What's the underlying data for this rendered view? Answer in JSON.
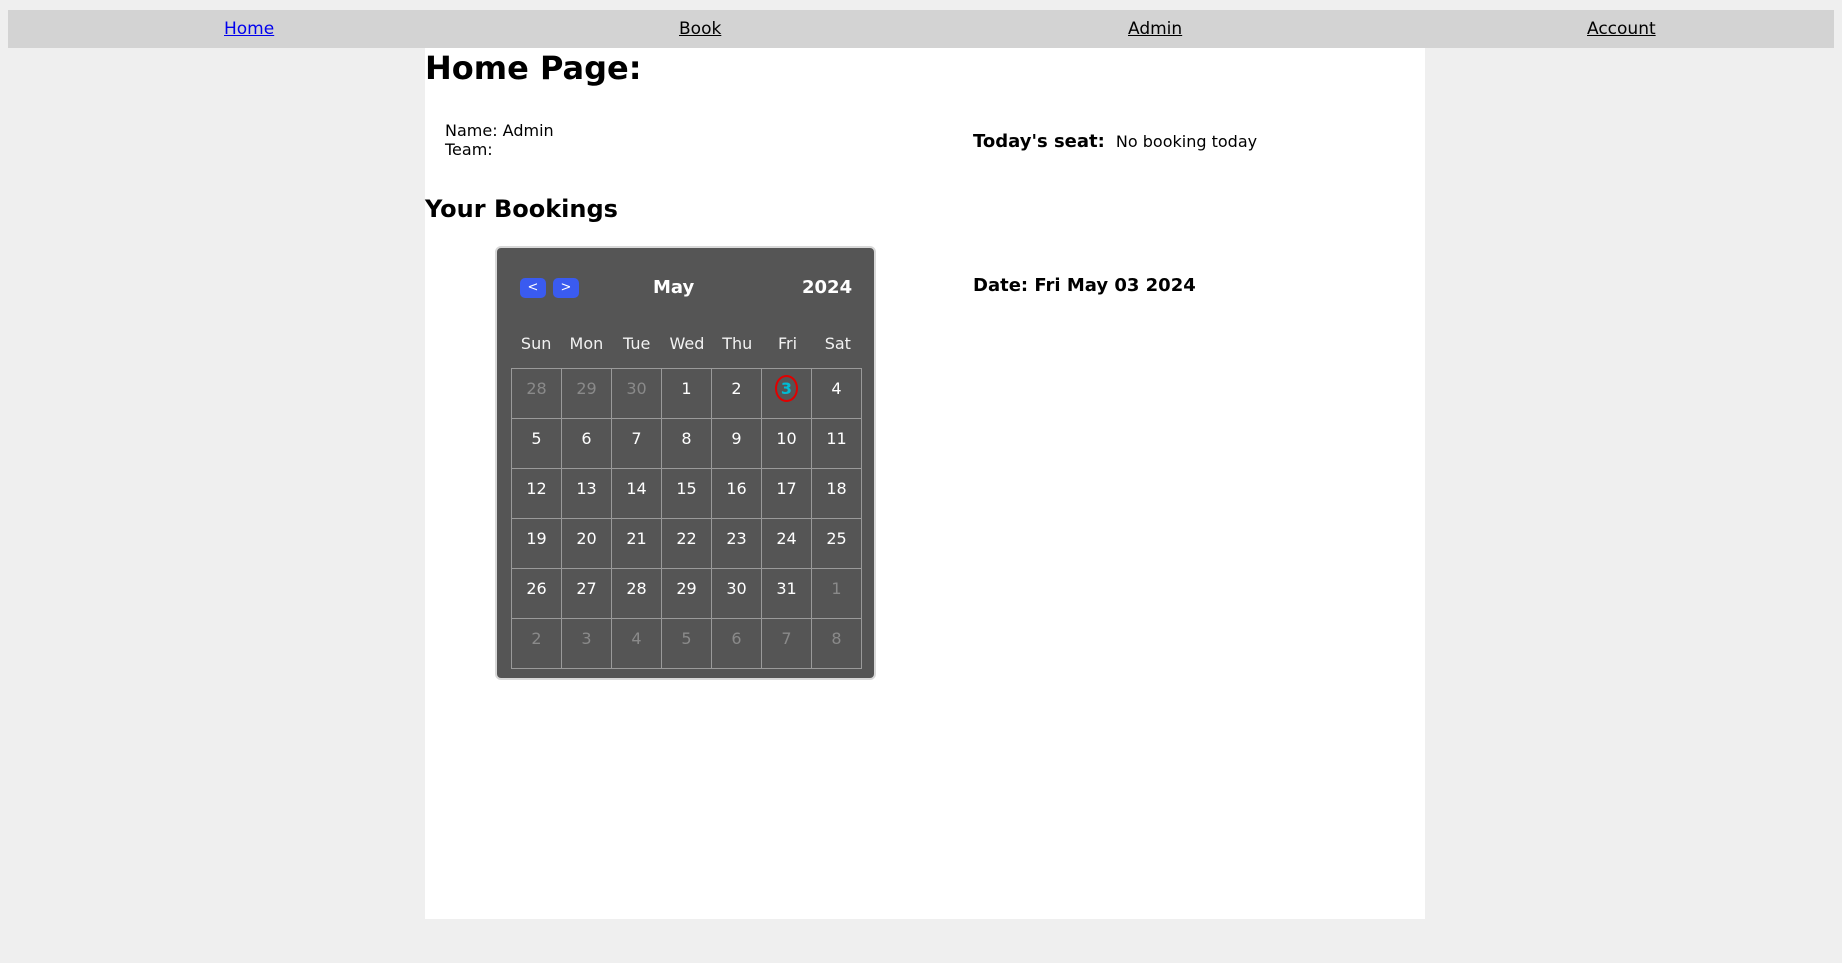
{
  "nav": {
    "items": [
      {
        "label": "Home"
      },
      {
        "label": "Book"
      },
      {
        "label": "Admin"
      },
      {
        "label": "Account"
      }
    ]
  },
  "page": {
    "title": "Home Page:",
    "name_line": "Name: Admin",
    "team_line": "Team:",
    "seat_label": "Today's seat:",
    "seat_value": "No booking today",
    "bookings_title": "Your Bookings",
    "date_line": "Date: Fri May 03 2024"
  },
  "calendar": {
    "prev_label": "<",
    "next_label": ">",
    "month": "May",
    "year": "2024",
    "weekdays": [
      "Sun",
      "Mon",
      "Tue",
      "Wed",
      "Thu",
      "Fri",
      "Sat"
    ],
    "weeks": [
      [
        "28",
        "29",
        "30",
        "1",
        "2",
        "3",
        "4"
      ],
      [
        "5",
        "6",
        "7",
        "8",
        "9",
        "10",
        "11"
      ],
      [
        "12",
        "13",
        "14",
        "15",
        "16",
        "17",
        "18"
      ],
      [
        "19",
        "20",
        "21",
        "22",
        "23",
        "24",
        "25"
      ],
      [
        "26",
        "27",
        "28",
        "29",
        "30",
        "31",
        "1"
      ],
      [
        "2",
        "3",
        "4",
        "5",
        "6",
        "7",
        "8"
      ]
    ],
    "selected_day": "3",
    "colors": {
      "background": "#555555",
      "button": "#3a5bf0",
      "selected_text": "#00bcd4",
      "selected_ring": "#e00000",
      "other_month_text": "#8a8a8a"
    }
  }
}
